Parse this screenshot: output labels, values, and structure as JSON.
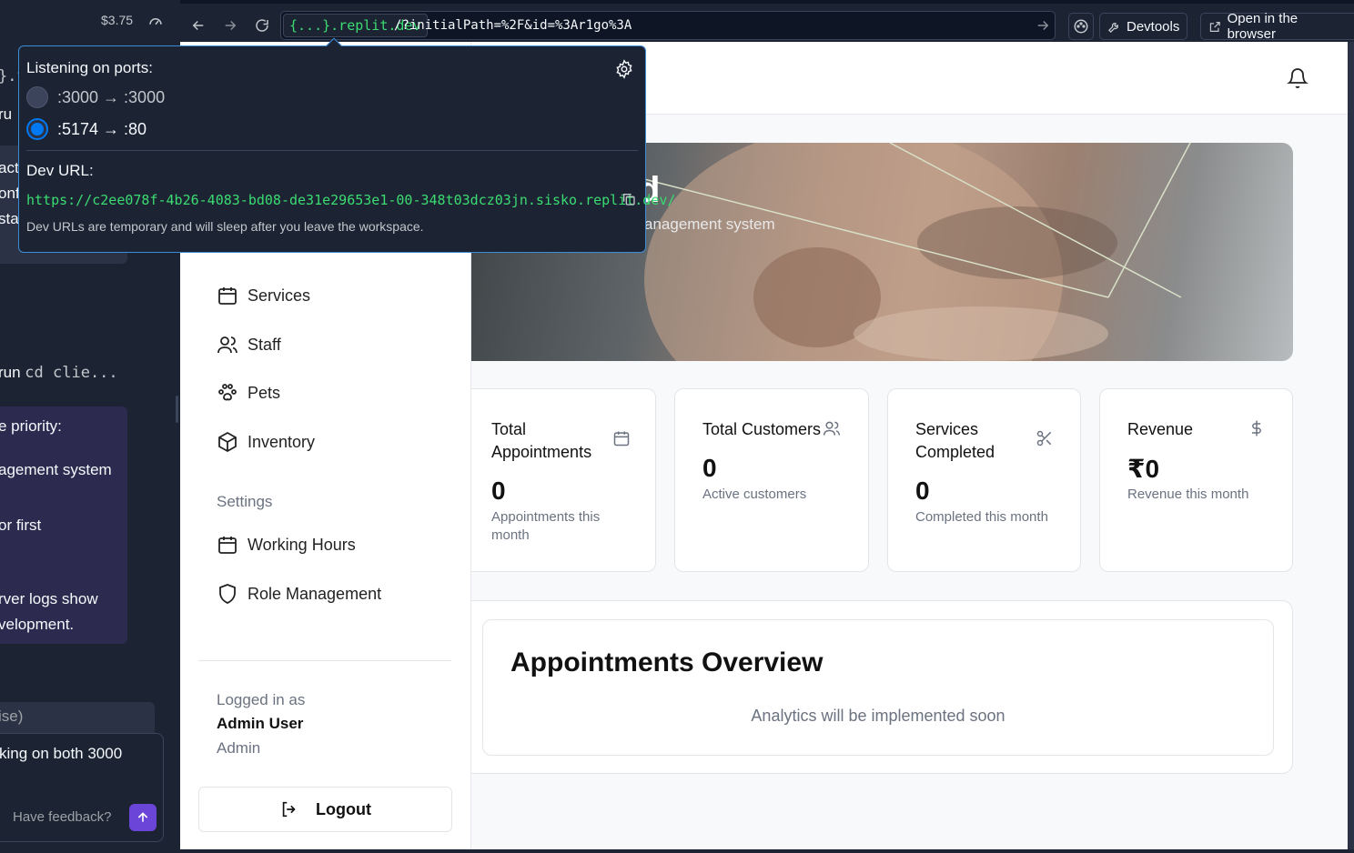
{
  "left_panel": {
    "cost": "$3.75",
    "fragments": {
      "f1": "}.t",
      "f2": "ru",
      "f3": "act",
      "f4": "onf",
      "f5": "sta",
      "f6_prefix": "run ",
      "f6_code": "cd clie...",
      "chat_lines": [
        "e priority:",
        "agement system",
        "or first",
        "rver logs show",
        "velopment."
      ],
      "input_hint": "ise)",
      "input_text": "king on both 3000"
    },
    "feedback_label": "Have feedback?"
  },
  "browser": {
    "domain": "{...}.replit.dev",
    "path": "/?initialPath=%2F&id=%3Ar1go%3A",
    "devtools_label": "Devtools",
    "open_label": "Open in the browser"
  },
  "popup": {
    "ports_heading": "Listening on ports:",
    "ports": [
      {
        "label": ":3000 → :3000",
        "selected": false
      },
      {
        "label": ":5174 → :80",
        "selected": true
      }
    ],
    "dev_url_heading": "Dev URL:",
    "dev_url": "https://c2ee078f-4b26-4083-bd08-de31e29653e1-00-348t03dcz03jn.sisko.replit.dev/",
    "note": "Dev URLs are temporary and will sleep after you leave the workspace."
  },
  "app": {
    "hero": {
      "title_fragment": "d",
      "subtitle_fragment": "anagement system"
    },
    "sidebar": {
      "items": [
        {
          "label": "Services",
          "icon": "calendar-icon"
        },
        {
          "label": "Staff",
          "icon": "users-icon"
        },
        {
          "label": "Pets",
          "icon": "paw-icon"
        },
        {
          "label": "Inventory",
          "icon": "package-icon"
        }
      ],
      "settings_label": "Settings",
      "settings_items": [
        {
          "label": "Working Hours",
          "icon": "calendar-icon"
        },
        {
          "label": "Role Management",
          "icon": "shield-icon"
        }
      ],
      "logged_in_label": "Logged in as",
      "user_name": "Admin User",
      "user_role": "Admin",
      "logout_label": "Logout"
    },
    "stats": [
      {
        "title": "Total Appointments",
        "value": "0",
        "note": "Appointments this month",
        "icon": "calendar-icon"
      },
      {
        "title": "Total Customers",
        "value": "0",
        "note": "Active customers",
        "icon": "users-icon"
      },
      {
        "title": "Services Completed",
        "value": "0",
        "note": "Completed this month",
        "icon": "scissors-icon"
      },
      {
        "title": "Revenue",
        "value": "₹0",
        "note": "Revenue this month",
        "icon": "dollar-icon"
      }
    ],
    "overview": {
      "title": "Appointments Overview",
      "note": "Analytics will be implemented soon"
    }
  },
  "colors": {
    "replit_bg": "#1c2333",
    "accent_blue": "#0079f2",
    "url_green": "#3bdc71",
    "send_purple": "#6b45d8"
  }
}
